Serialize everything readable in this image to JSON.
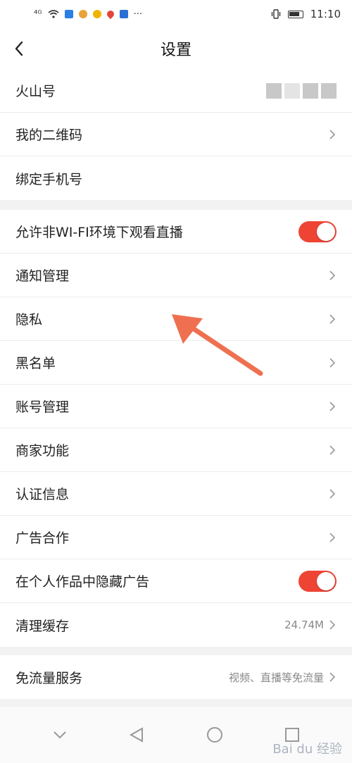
{
  "status_bar": {
    "signal": "⁴ᴳ",
    "more": "···",
    "time": "11:10"
  },
  "header": {
    "title": "设置"
  },
  "sections": [
    {
      "rows": [
        {
          "label": "火山号",
          "type": "value-redacted"
        },
        {
          "label": "我的二维码",
          "type": "link"
        },
        {
          "label": "绑定手机号",
          "type": "plain"
        }
      ]
    },
    {
      "rows": [
        {
          "label": "允许非WI-FI环境下观看直播",
          "type": "toggle",
          "on": true
        },
        {
          "label": "通知管理",
          "type": "link"
        },
        {
          "label": "隐私",
          "type": "link"
        },
        {
          "label": "黑名单",
          "type": "link"
        },
        {
          "label": "账号管理",
          "type": "link"
        },
        {
          "label": "商家功能",
          "type": "link"
        },
        {
          "label": "认证信息",
          "type": "link"
        },
        {
          "label": "广告合作",
          "type": "link"
        },
        {
          "label": "在个人作品中隐藏广告",
          "type": "toggle",
          "on": true
        },
        {
          "label": "清理缓存",
          "type": "link",
          "value": "24.74M"
        }
      ]
    },
    {
      "rows": [
        {
          "label": "免流量服务",
          "type": "link",
          "value": "视频、直播等免流量"
        }
      ]
    }
  ],
  "colors": {
    "toggle_on": "#ee4433",
    "annotation_arrow": "#ee7050"
  },
  "watermark": {
    "text": "Bai du 经验"
  }
}
